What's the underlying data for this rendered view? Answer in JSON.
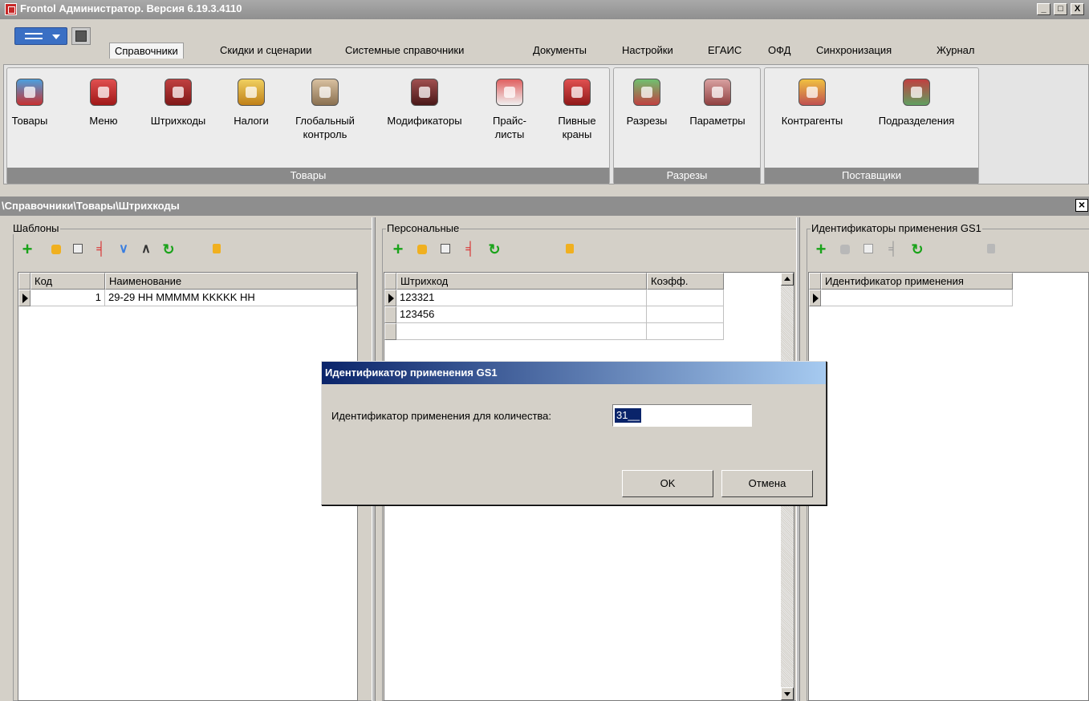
{
  "window": {
    "title": "Frontol Администратор. Версия 6.19.3.4110",
    "controls": [
      "_",
      "□",
      "X"
    ]
  },
  "tabs": [
    {
      "label": "Справочники",
      "active": true
    },
    {
      "label": "Скидки и сценарии"
    },
    {
      "label": "Системные справочники"
    },
    {
      "label": "Документы"
    },
    {
      "label": "Настройки"
    },
    {
      "label": "ЕГАИС"
    },
    {
      "label": "ОФД"
    },
    {
      "label": "Синхронизация"
    },
    {
      "label": "Журнал"
    }
  ],
  "ribbon": {
    "groups": [
      {
        "label": "Товары",
        "buttons": [
          {
            "label": "Товары",
            "icon": "bottles-icon"
          },
          {
            "label": "Меню",
            "icon": "menu-book-icon"
          },
          {
            "label": "Штрихкоды",
            "icon": "barcode-icon"
          },
          {
            "label": "Налоги",
            "icon": "coins-icon"
          },
          {
            "label": "Глобальный контроль",
            "line1": "Глобальный",
            "line2": "контроль",
            "icon": "box-tools-icon"
          },
          {
            "label": "Модификаторы",
            "icon": "wine-icon"
          },
          {
            "label": "Прайс-листы",
            "line1": "Прайс-",
            "line2": "листы",
            "icon": "pricelist-icon"
          },
          {
            "label": "Пивные краны",
            "line1": "Пивные",
            "line2": "краны",
            "icon": "beer-tap-icon"
          }
        ]
      },
      {
        "label": "Разрезы",
        "buttons": [
          {
            "label": "Разрезы",
            "icon": "slices-icon"
          },
          {
            "label": "Параметры",
            "icon": "tools-icon"
          }
        ]
      },
      {
        "label": "Поставщики",
        "buttons": [
          {
            "label": "Контрагенты",
            "icon": "worker-icon"
          },
          {
            "label": "Подразделения",
            "icon": "store-icon"
          }
        ]
      }
    ]
  },
  "path": "\\Справочники\\Товары\\Штрихкоды",
  "panels": {
    "templates": {
      "title": "Шаблоны",
      "columns": [
        "Код",
        "Наименование"
      ],
      "rows": [
        {
          "code": "1",
          "name": "29-29 НН ММMMM KKKKK НН"
        }
      ]
    },
    "personal": {
      "title": "Персональные",
      "columns": [
        "Штрихкод",
        "Коэфф."
      ],
      "rows": [
        {
          "barcode": "123321",
          "coef": ""
        },
        {
          "barcode": "123456",
          "coef": ""
        },
        {
          "barcode": "",
          "coef": ""
        }
      ]
    },
    "gs1": {
      "title": "Идентификаторы применения GS1",
      "columns": [
        "Идентификатор применения"
      ],
      "rows": [
        {
          "id": ""
        }
      ]
    }
  },
  "toolbar_icons": [
    "add-icon",
    "edit-icon",
    "copy-icon",
    "delete-icon",
    "move-down-icon",
    "move-up-icon",
    "refresh-icon",
    "clear-icon"
  ],
  "dialog": {
    "title": "Идентификатор применения GS1",
    "label": "Идентификатор применения для количества:",
    "value": "31__",
    "ok": "OK",
    "cancel": "Отмена"
  },
  "colors": {
    "title_bar": "#8f8f8f",
    "dialog_title": "#0a246a",
    "add": "#1aa31a",
    "delete": "#d93030",
    "refresh": "#1aa31a"
  }
}
